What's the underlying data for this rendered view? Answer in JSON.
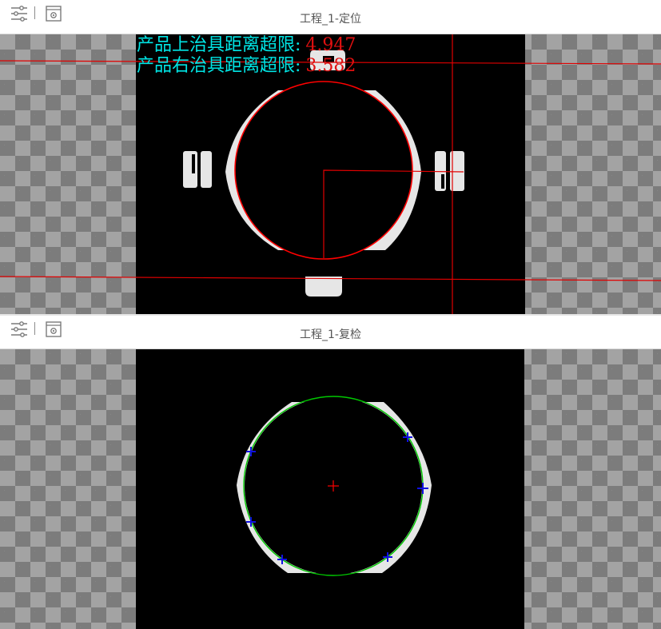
{
  "top_pane": {
    "title": "工程_1-定位",
    "toolbar": {
      "settings_icon": "sliders-icon",
      "window_icon": "window-gear-icon"
    },
    "overlay": [
      {
        "label": "产品上治具距离超限:",
        "value": "4.947"
      },
      {
        "label": "产品右治具距离超限:",
        "value": "3.582"
      }
    ]
  },
  "bottom_pane": {
    "title": "工程_1-复检",
    "toolbar": {
      "settings_icon": "sliders-icon",
      "window_icon": "window-gear-icon"
    }
  },
  "colors": {
    "overlay_label": "#00e5e5",
    "overlay_value": "#e01010",
    "fit_circle_top": "#ff0000",
    "fit_circle_bottom": "#00c800",
    "edge_points": "#1010e0",
    "center_mark": "#ff0000",
    "part": "#e6e6e6",
    "image_background": "#000000"
  }
}
